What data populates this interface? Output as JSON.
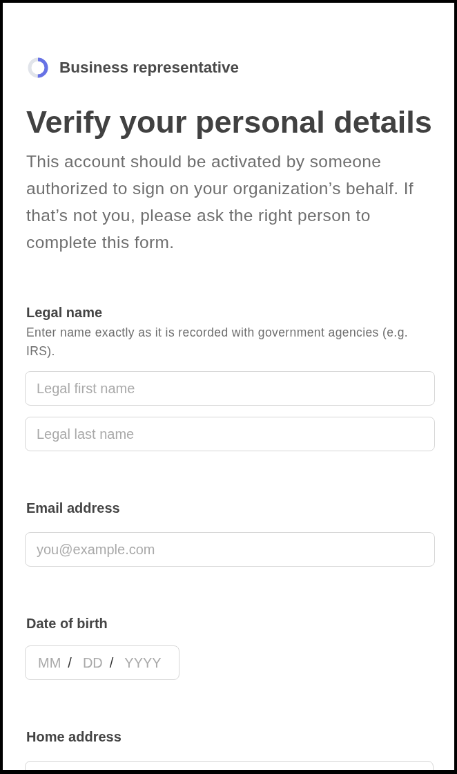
{
  "progress": {
    "level": 0.5,
    "label": "Business representative"
  },
  "title": "Verify your personal details",
  "description": "This account should be activated by someone authorized to sign on your organization’s behalf. If that’s not you, please ask the right person to complete this form.",
  "sections": [
    {
      "kind": "text_group",
      "label": "Legal name",
      "hint": "Enter name exactly as it is recorded with government agencies (e.g. IRS).",
      "fields": [
        {
          "placeholder": "Legal first name"
        },
        {
          "placeholder": "Legal last name"
        }
      ]
    },
    {
      "kind": "text_group",
      "label": "Email address",
      "fields": [
        {
          "placeholder": "you@example.com"
        }
      ]
    },
    {
      "kind": "date",
      "label": "Date of birth",
      "parts": [
        {
          "placeholder": "MM"
        },
        {
          "placeholder": "DD"
        },
        {
          "placeholder": "YYYY"
        }
      ],
      "separators": [
        "/",
        "/"
      ]
    },
    {
      "kind": "select",
      "label": "Home address"
    }
  ]
}
